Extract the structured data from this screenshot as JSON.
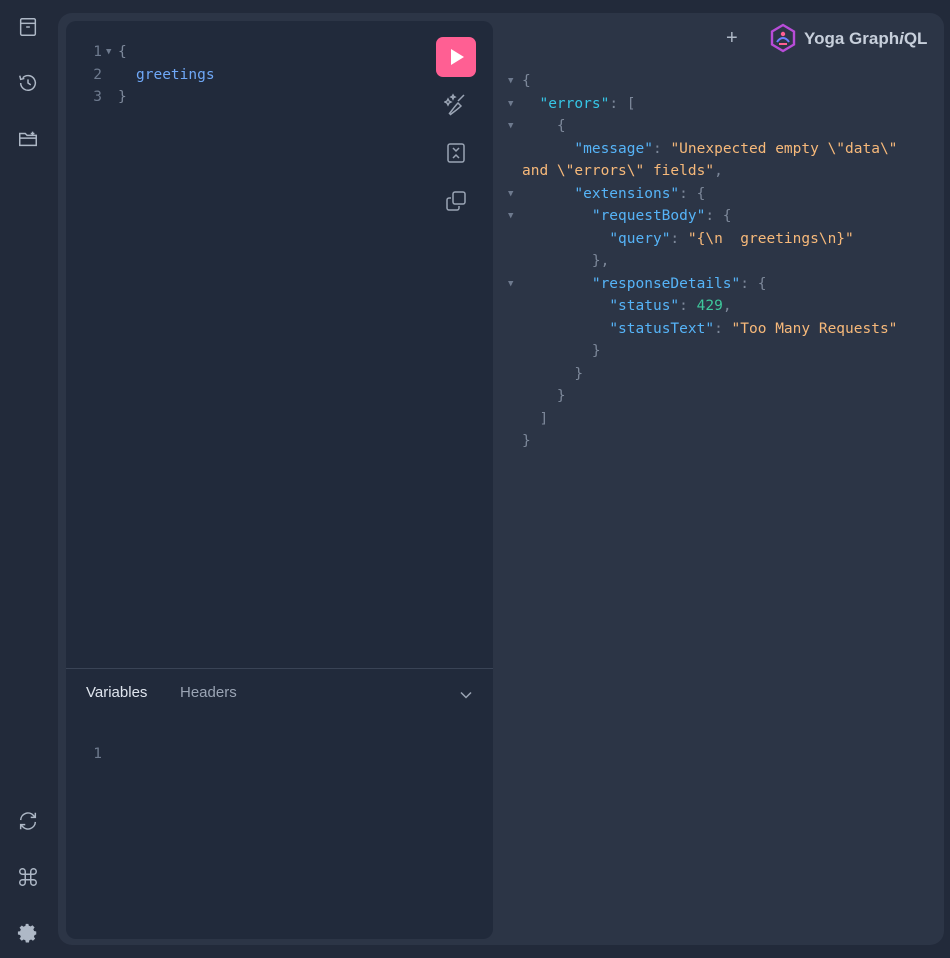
{
  "app": {
    "name_prefix": "Yoga Graph",
    "name_italic": "i",
    "name_suffix": "QL",
    "accent": "#ff5f93"
  },
  "sidebar": {
    "top_icons": [
      "documentation-icon",
      "history-icon",
      "explorer-icon"
    ],
    "bottom_icons": [
      "refetch-schema-icon",
      "keyboard-shortcuts-icon",
      "settings-icon"
    ]
  },
  "query_editor": {
    "lines": [
      {
        "num": "1",
        "text": "{"
      },
      {
        "num": "2",
        "text": "greetings"
      },
      {
        "num": "3",
        "text": "}"
      }
    ]
  },
  "toolbar": {
    "run_icon": "play-icon",
    "prettify_icon": "magic-wand-icon",
    "merge_icon": "merge-fragments-icon",
    "copy_icon": "copy-icon"
  },
  "bottom_tabs": {
    "variables": "Variables",
    "headers": "Headers"
  },
  "variables_editor": {
    "line_num": "1"
  },
  "result": {
    "new_tab": "+",
    "json": {
      "open_brace": "{",
      "errors_key": "\"errors\"",
      "message_key": "\"message\"",
      "message_val_1": "\"Unexpected empty \\\"data\\\"",
      "message_val_2": "and \\\"errors\\\" fields\"",
      "extensions_key": "\"extensions\"",
      "requestBody_key": "\"requestBody\"",
      "query_key": "\"query\"",
      "query_val": "\"{\\n  greetings\\n}\"",
      "responseDetails_key": "\"responseDetails\"",
      "status_key": "\"status\"",
      "status_val": "429",
      "statusText_key": "\"statusText\"",
      "statusText_val": "\"Too Many Requests\""
    }
  }
}
